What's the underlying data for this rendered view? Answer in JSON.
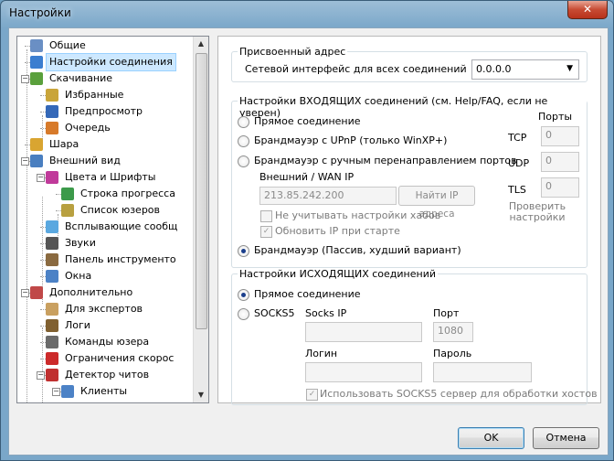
{
  "window": {
    "title": "Настройки",
    "close_glyph": "✕"
  },
  "tree": {
    "items": [
      {
        "label": "Общие",
        "icon": "user-icon",
        "color": "#6a8fc4"
      },
      {
        "label": "Настройки соединения",
        "icon": "globe-icon",
        "color": "#3b7ed0",
        "selected": true
      },
      {
        "label": "Скачивание",
        "icon": "download-icon",
        "color": "#5aa03c"
      },
      {
        "label": "Избранные",
        "icon": "favorites-icon",
        "color": "#c9a53a"
      },
      {
        "label": "Предпросмотр",
        "icon": "preview-icon",
        "color": "#3468b8"
      },
      {
        "label": "Очередь",
        "icon": "queue-icon",
        "color": "#d77a2a"
      },
      {
        "label": "Шара",
        "icon": "share-icon",
        "color": "#d9a531"
      },
      {
        "label": "Внешний вид",
        "icon": "monitor-icon",
        "color": "#4a7fc0"
      },
      {
        "label": "Цвета и Шрифты",
        "icon": "palette-icon",
        "color": "#c03a9a"
      },
      {
        "label": "Строка прогресса",
        "icon": "progress-icon",
        "color": "#3c9a4a"
      },
      {
        "label": "Список юзеров",
        "icon": "users-list-icon",
        "color": "#b8a040"
      },
      {
        "label": "Всплывающие сообщ",
        "icon": "popup-icon",
        "color": "#5aa8e0"
      },
      {
        "label": "Звуки",
        "icon": "sound-icon",
        "color": "#555555"
      },
      {
        "label": "Панель инструменто",
        "icon": "toolbar-icon",
        "color": "#8a6a40"
      },
      {
        "label": "Окна",
        "icon": "windows-icon",
        "color": "#4c82c6"
      },
      {
        "label": "Дополнительно",
        "icon": "tools-icon",
        "color": "#c04848"
      },
      {
        "label": "Для экспертов",
        "icon": "expert-icon",
        "color": "#c9a060"
      },
      {
        "label": "Логи",
        "icon": "logs-icon",
        "color": "#806030"
      },
      {
        "label": "Команды юзера",
        "icon": "commands-icon",
        "color": "#6a6a6a"
      },
      {
        "label": "Ограничения скорос",
        "icon": "speed-limit-icon",
        "color": "#cc2a2a"
      },
      {
        "label": "Детектор читов",
        "icon": "detector-icon",
        "color": "#c03030"
      },
      {
        "label": "Клиенты",
        "icon": "clients-icon",
        "color": "#4c82c6"
      }
    ]
  },
  "assigned": {
    "legend": "Присвоенный адрес",
    "label": "Сетевой интерфейс для всех соединений",
    "value": "0.0.0.0"
  },
  "incoming": {
    "legend": "Настройки ВХОДЯЩИХ соединений (см. Help/FAQ, если не уверен)",
    "opt_direct": "Прямое соединение",
    "opt_upnp": "Брандмауэр с UPnP (только WinXP+)",
    "opt_manual": "Брандмауэр с ручным перенаправлением портов",
    "wan_label": "Внешний / WAN IP",
    "wan_value": "213.85.242.200",
    "find_ip": "Найти IP адреса",
    "ignore_hubs": "Не учитывать настройки хабов",
    "update_ip": "Обновить IP при старте",
    "opt_passive": "Брандмауэр (Пассив, худший вариант)",
    "ports_title": "Порты",
    "tcp_label": "TCP",
    "tcp_value": "0",
    "udp_label": "UDP",
    "udp_value": "0",
    "tls_label": "TLS",
    "tls_value": "0",
    "check_settings": "Проверить настройки"
  },
  "outgoing": {
    "legend": "Настройки ИСХОДЯЩИХ соединений",
    "opt_direct": "Прямое соединение",
    "opt_socks": "SOCKS5",
    "socks_ip_label": "Socks IP",
    "port_label": "Порт",
    "port_value": "1080",
    "login_label": "Логин",
    "password_label": "Пароль",
    "use_socks": "Использовать SOCKS5 сервер для обработки хостов"
  },
  "buttons": {
    "ok": "OK",
    "cancel": "Отмена"
  }
}
